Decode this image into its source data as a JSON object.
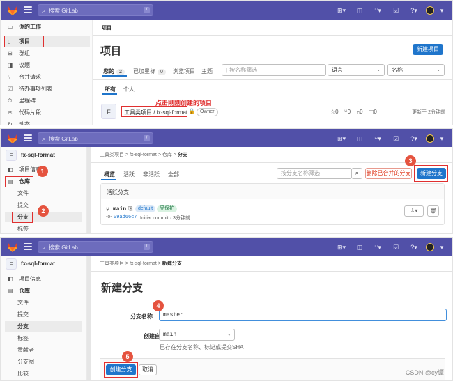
{
  "search": {
    "placeholder": "搜索 GitLab",
    "slash": "/"
  },
  "panel1": {
    "sidebar": {
      "items": [
        {
          "label": "你的工作",
          "icon": "briefcase-icon"
        },
        {
          "label": "项目",
          "icon": "project-icon"
        },
        {
          "label": "群组",
          "icon": "group-icon"
        },
        {
          "label": "议题",
          "icon": "issue-icon"
        },
        {
          "label": "合并请求",
          "icon": "merge-request-icon"
        },
        {
          "label": "待办事项列表",
          "icon": "todo-icon"
        },
        {
          "label": "里程碑",
          "icon": "milestone-icon"
        },
        {
          "label": "代码片段",
          "icon": "snippet-icon"
        },
        {
          "label": "动态",
          "icon": "activity-icon"
        }
      ]
    },
    "breadcrumb": "项目",
    "title": "项目",
    "new_project": "新建项目",
    "tabs": [
      {
        "label": "您的",
        "count": "2"
      },
      {
        "label": "已加星标",
        "count": "0"
      },
      {
        "label": "浏览项目",
        "count": ""
      },
      {
        "label": "主题",
        "count": ""
      }
    ],
    "filter_placeholder": "按名称筛选",
    "language_select": "语言",
    "sort_select": "名称",
    "subtabs": [
      "所有",
      "个人"
    ],
    "annotation": "点击刚刚创建的项目",
    "project": {
      "avatar": "F",
      "path": "工具类项目 / fx-sql-format",
      "role": "Owner",
      "stars": "0",
      "forks": "0",
      "merge_requests": "0",
      "issues": "0",
      "updated": "更新于 2分钟前"
    }
  },
  "panel2": {
    "project_name": "fx-sql-format",
    "project_avatar": "F",
    "sidebar": {
      "items": [
        {
          "label": "项目信息",
          "icon": "info-icon"
        },
        {
          "label": "仓库",
          "icon": "repository-icon"
        }
      ],
      "subitems": [
        "文件",
        "提交",
        "分支",
        "标签"
      ]
    },
    "breadcrumb": [
      "工具类项目",
      "fx-sql-format",
      "仓库",
      "分支"
    ],
    "tabs": [
      "概览",
      "活跃",
      "非活跃",
      "全部"
    ],
    "filter_placeholder": "按分支名称筛选",
    "delete_merged": "删除已合并的分支",
    "new_branch": "新建分支",
    "section_title": "活跃分支",
    "branch": {
      "name": "main",
      "badge_default": "default",
      "badge_protected": "受保护",
      "commit": "09ad66c7",
      "commit_message": "Initial commit · 3分钟前"
    },
    "markers": [
      "1",
      "2",
      "3"
    ]
  },
  "panel3": {
    "project_name": "fx-sql-format",
    "project_avatar": "F",
    "sidebar": {
      "items": [
        {
          "label": "项目信息",
          "icon": "info-icon"
        },
        {
          "label": "仓库",
          "icon": "repository-icon"
        }
      ],
      "subitems": [
        "文件",
        "提交",
        "分支",
        "标签",
        "贡献者",
        "分支图",
        "比较"
      ]
    },
    "breadcrumb": [
      "工具类项目",
      "fx-sql-format",
      "新建分支"
    ],
    "title": "新建分支",
    "branch_name_label": "分支名称",
    "branch_name_value": "master",
    "create_from_label": "创建自",
    "create_from_value": "main",
    "create_from_help": "已存在分支名称、标记或提交SHA",
    "create_button": "创建分支",
    "cancel_button": "取消",
    "markers": [
      "4",
      "5"
    ]
  },
  "watermark": "CSDN @cy谭",
  "colors": {
    "topbar": "#5150a8",
    "primary": "#1f75cb",
    "annotation": "#e03030",
    "marker": "#e5533f"
  }
}
